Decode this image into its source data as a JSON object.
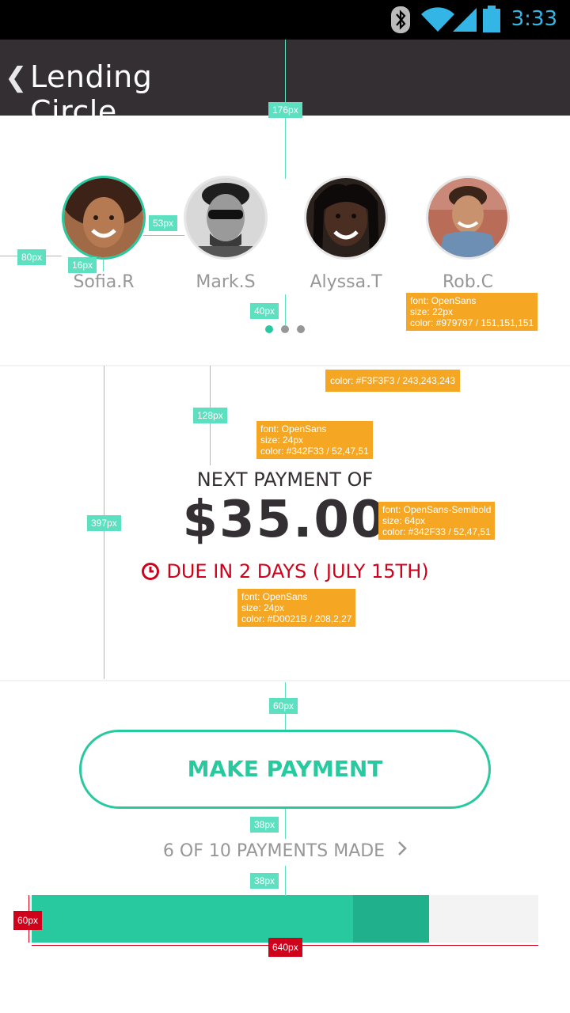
{
  "status_bar": {
    "time": "3:33",
    "icons": [
      "bluetooth-icon",
      "wifi-icon",
      "signal-icon",
      "battery-icon"
    ],
    "accent_color": "#33B5E5"
  },
  "app_bar": {
    "back_icon": "chevron-left-icon",
    "title": "Lending Circle",
    "background": "#342F33"
  },
  "members": [
    {
      "name": "Sofia.R",
      "active": true
    },
    {
      "name": "Mark.S",
      "active": false
    },
    {
      "name": "Alyssa.T",
      "active": false
    },
    {
      "name": "Rob.C",
      "active": false
    }
  ],
  "pager": {
    "pages": 3,
    "active_index": 0
  },
  "payment": {
    "label": "NEXT PAYMENT OF",
    "amount": "$35.00",
    "due_icon": "clock-icon",
    "due_text": "DUE IN 2 DAYS ( JULY 15TH)"
  },
  "actions": {
    "make_payment_label": "MAKE PAYMENT"
  },
  "progress": {
    "label": "6 OF 10 PAYMENTS MADE",
    "chevron_icon": "chevron-right-icon",
    "payments_made": 6,
    "payments_total": 10,
    "current_payment_index": 7
  },
  "colors": {
    "accent": "#29C9A0",
    "accent_dark": "#21B08C",
    "text_dark": "#342F33",
    "text_gray": "#979797",
    "alert_red": "#D0021B",
    "divider": "#F3F3F3"
  },
  "annotations": {
    "dim_176": "176px",
    "dim_80": "80px",
    "dim_53": "53px",
    "dim_16": "16px",
    "dim_40": "40px",
    "dim_128": "128px",
    "dim_397": "397px",
    "dim_60": "60px",
    "dim_38a": "38px",
    "dim_38b": "38px",
    "dim_60_red": "60px",
    "dim_640_red": "640px",
    "name_spec": [
      "font: OpenSans",
      "size: 22px",
      "color: #979797 / 151,151,151"
    ],
    "divider_spec": "color: #F3F3F3 / 243,243,243",
    "label_spec": [
      "font: OpenSans",
      "size: 24px",
      "color: #342F33 / 52,47,51"
    ],
    "amount_spec": [
      "font: OpenSans-Semibold",
      "size: 64px",
      "color: #342F33 / 52,47,51"
    ],
    "due_spec": [
      "font: OpenSans",
      "size: 24px",
      "color: #D0021B / 208,2,27"
    ]
  }
}
